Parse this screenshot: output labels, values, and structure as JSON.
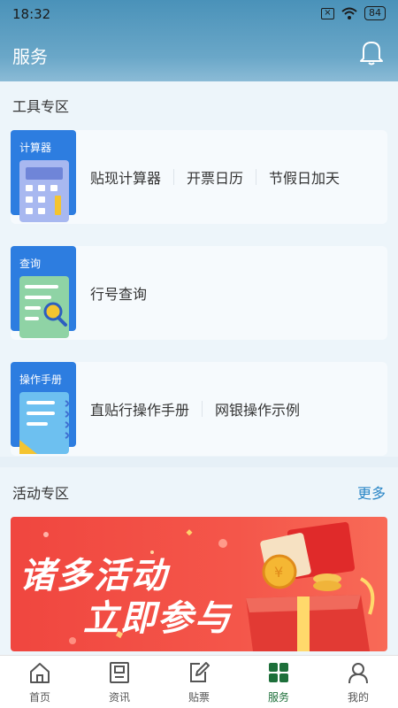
{
  "status_bar": {
    "time": "18:32",
    "battery": "84"
  },
  "header": {
    "title": "服务"
  },
  "tools": {
    "title": "工具专区",
    "cards": [
      {
        "icon_label": "计算器",
        "icon": "calculator-icon",
        "links": [
          "贴现计算器",
          "开票日历",
          "节假日加天"
        ]
      },
      {
        "icon_label": "查询",
        "icon": "search-document-icon",
        "links": [
          "行号查询"
        ]
      },
      {
        "icon_label": "操作手册",
        "icon": "manual-icon",
        "links": [
          "直贴行操作手册",
          "网银操作示例"
        ]
      }
    ]
  },
  "activity": {
    "title": "活动专区",
    "more": "更多",
    "banner": {
      "line1": "诸多活动",
      "line2": "立即参与"
    }
  },
  "nav": {
    "items": [
      {
        "label": "首页",
        "icon": "home-icon"
      },
      {
        "label": "资讯",
        "icon": "news-icon"
      },
      {
        "label": "贴票",
        "icon": "edit-icon"
      },
      {
        "label": "服务",
        "icon": "grid-icon",
        "active": true
      },
      {
        "label": "我的",
        "icon": "person-icon"
      }
    ]
  },
  "colors": {
    "accent": "#1d6f3a",
    "header": "#4a92b9",
    "banner": "#f0463f",
    "link": "#2a86c6"
  }
}
